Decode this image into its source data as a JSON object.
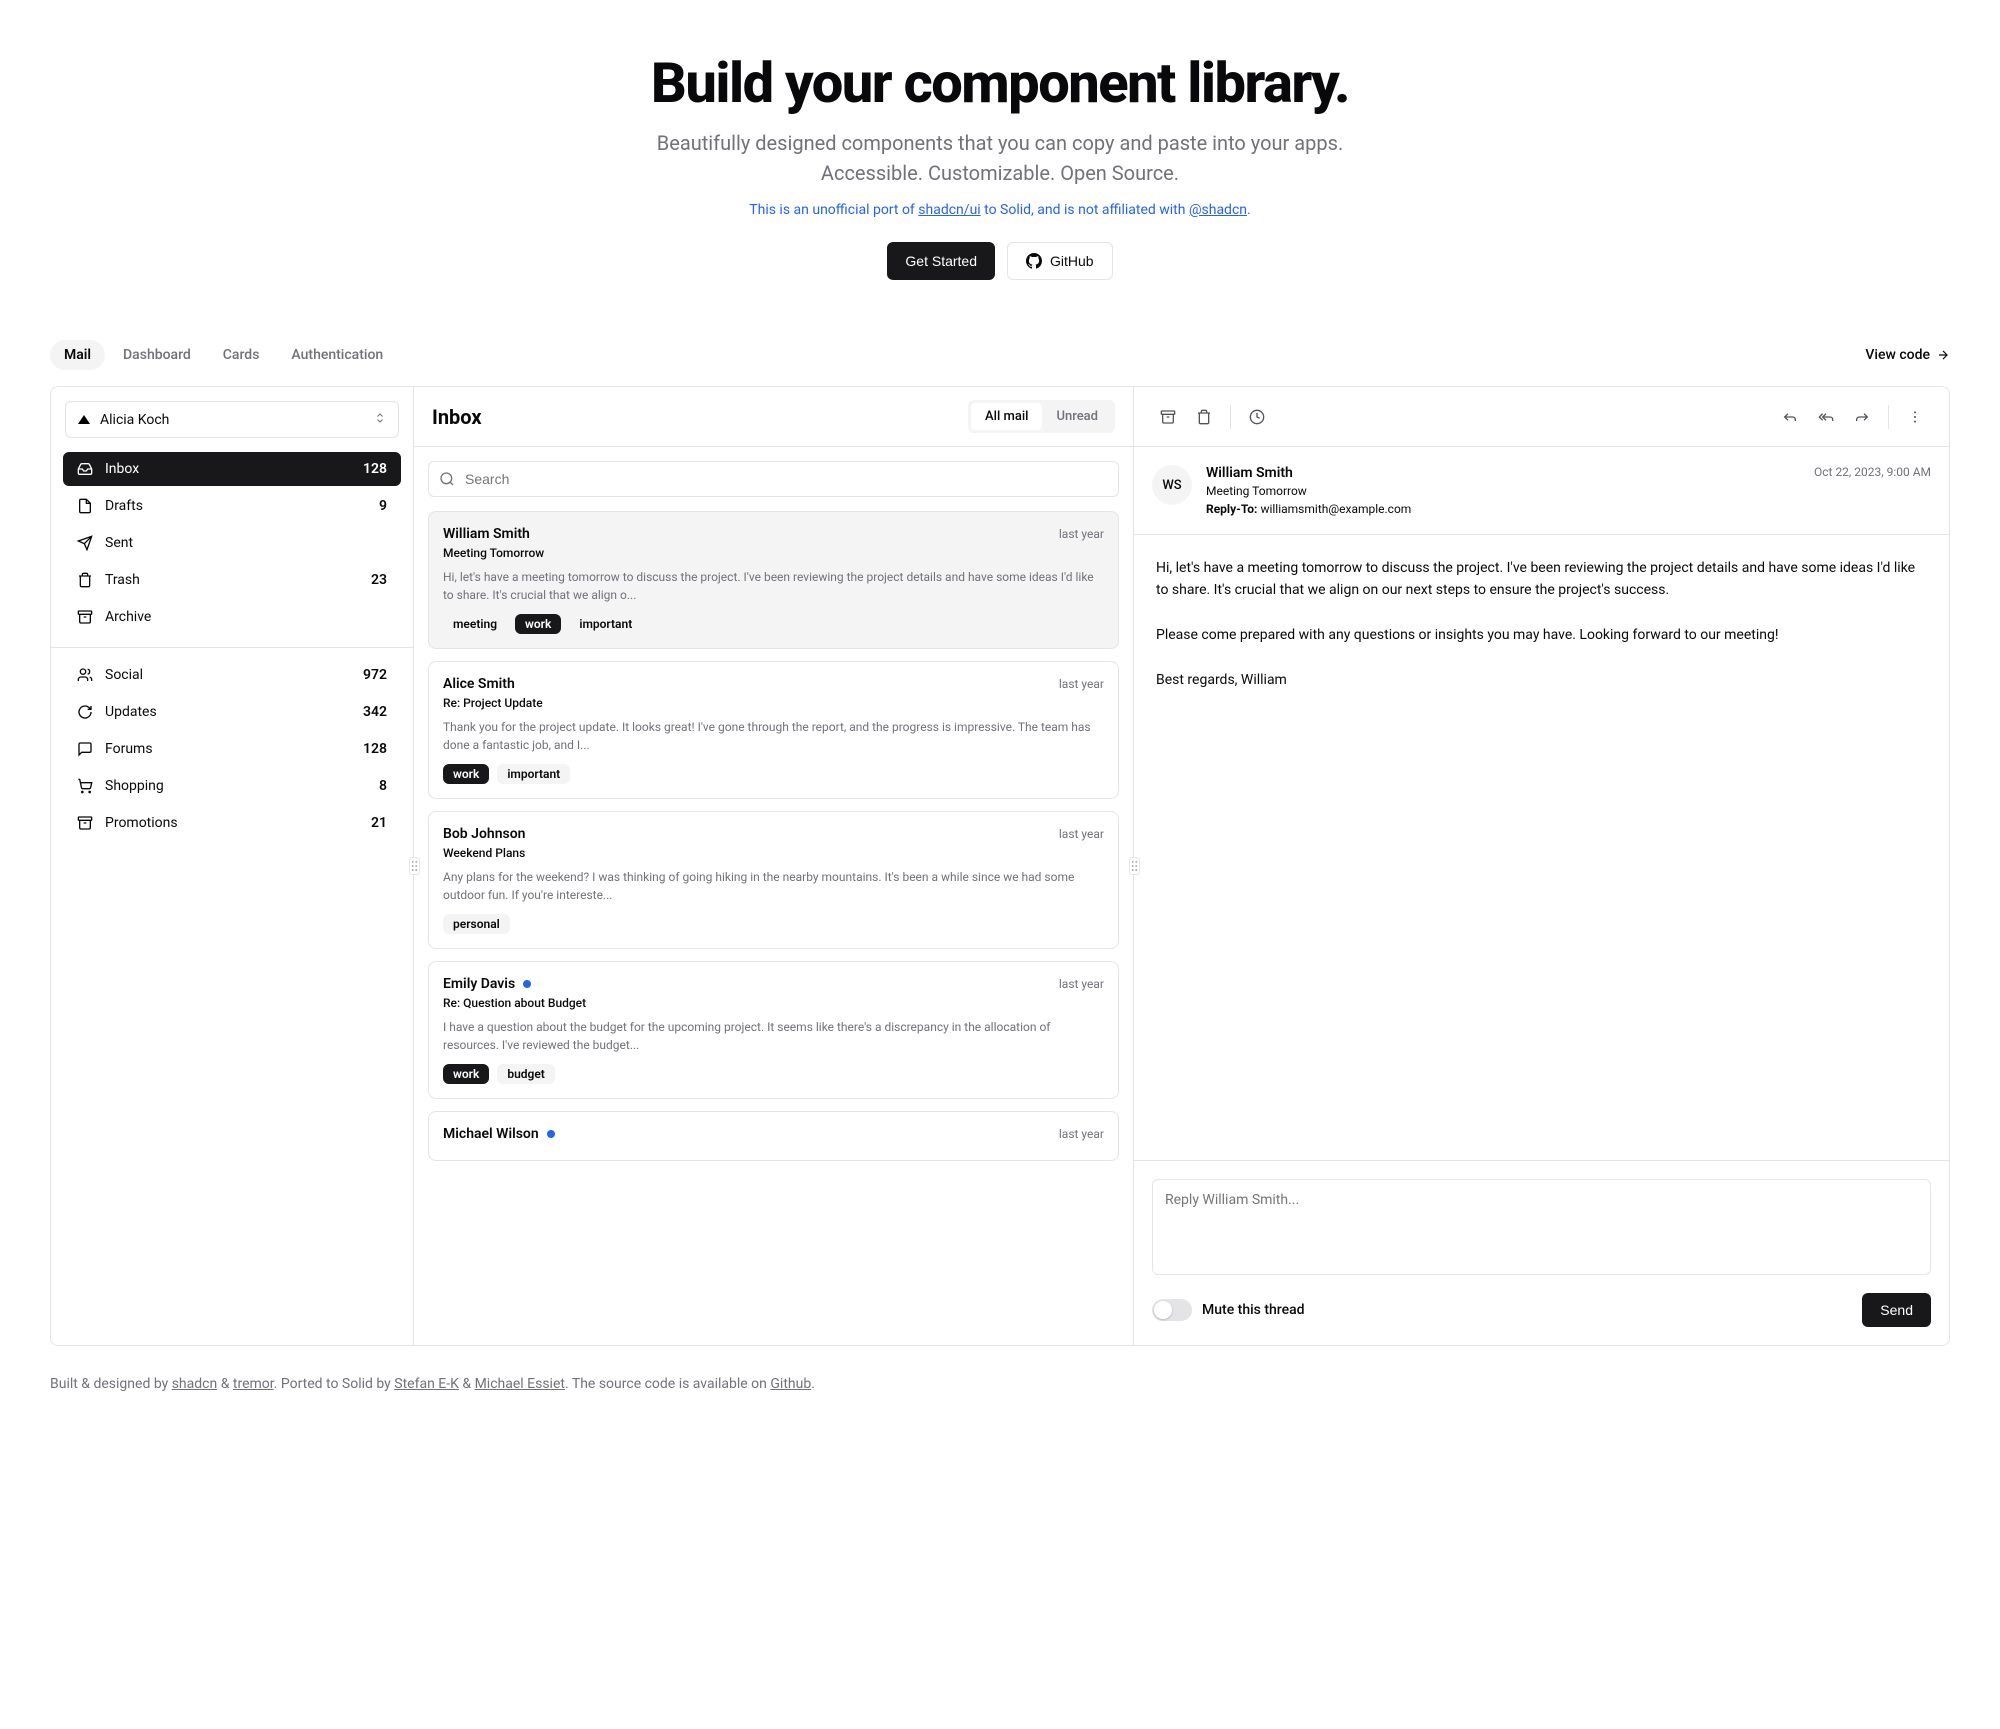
{
  "hero": {
    "title": "Build your component library.",
    "subtitle": "Beautifully designed components that you can copy and paste into your apps. Accessible. Customizable. Open Source.",
    "port_prefix": "This is an unofficial port of ",
    "port_link1": "shadcn/ui",
    "port_mid": " to Solid, and is not affiliated with ",
    "port_link2": "@shadcn",
    "get_started": "Get Started",
    "github": "GitHub"
  },
  "tabs": [
    "Mail",
    "Dashboard",
    "Cards",
    "Authentication"
  ],
  "view_code": "View code",
  "account": {
    "name": "Alicia Koch"
  },
  "nav_primary": [
    {
      "label": "Inbox",
      "count": "128",
      "active": true
    },
    {
      "label": "Drafts",
      "count": "9"
    },
    {
      "label": "Sent",
      "count": ""
    },
    {
      "label": "Trash",
      "count": "23"
    },
    {
      "label": "Archive",
      "count": ""
    }
  ],
  "nav_secondary": [
    {
      "label": "Social",
      "count": "972"
    },
    {
      "label": "Updates",
      "count": "342"
    },
    {
      "label": "Forums",
      "count": "128"
    },
    {
      "label": "Shopping",
      "count": "8"
    },
    {
      "label": "Promotions",
      "count": "21"
    }
  ],
  "inbox_title": "Inbox",
  "seg": {
    "all": "All mail",
    "unread": "Unread"
  },
  "search_placeholder": "Search",
  "mails": [
    {
      "from": "William Smith",
      "subject": "Meeting Tomorrow",
      "time": "last year",
      "unread": false,
      "selected": true,
      "preview": "Hi, let's have a meeting tomorrow to discuss the project. I've been reviewing the project details and have some ideas I'd like to share. It's crucial that we align o...",
      "tags": [
        {
          "t": "meeting"
        },
        {
          "t": "work",
          "d": true
        },
        {
          "t": "important"
        }
      ]
    },
    {
      "from": "Alice Smith",
      "subject": "Re: Project Update",
      "time": "last year",
      "unread": false,
      "preview": "Thank you for the project update. It looks great! I've gone through the report, and the progress is impressive. The team has done a fantastic job, and I...",
      "tags": [
        {
          "t": "work",
          "d": true
        },
        {
          "t": "important"
        }
      ]
    },
    {
      "from": "Bob Johnson",
      "subject": "Weekend Plans",
      "time": "last year",
      "unread": false,
      "preview": "Any plans for the weekend? I was thinking of going hiking in the nearby mountains. It's been a while since we had some outdoor fun. If you're intereste...",
      "tags": [
        {
          "t": "personal"
        }
      ]
    },
    {
      "from": "Emily Davis",
      "subject": "Re: Question about Budget",
      "time": "last year",
      "unread": true,
      "preview": "I have a question about the budget for the upcoming project. It seems like there's a discrepancy in the allocation of resources. I've reviewed the budget...",
      "tags": [
        {
          "t": "work",
          "d": true
        },
        {
          "t": "budget"
        }
      ]
    },
    {
      "from": "Michael Wilson",
      "subject": "",
      "time": "last year",
      "unread": true,
      "preview": "",
      "tags": []
    }
  ],
  "detail": {
    "initials": "WS",
    "from": "William Smith",
    "subject": "Meeting Tomorrow",
    "reply_to_label": "Reply-To:",
    "reply_to": "williamsmith@example.com",
    "date": "Oct 22, 2023, 9:00 AM",
    "body": "Hi, let's have a meeting tomorrow to discuss the project. I've been reviewing the project details and have some ideas I'd like to share. It's crucial that we align on our next steps to ensure the project's success.\n\nPlease come prepared with any questions or insights you may have. Looking forward to our meeting!\n\nBest regards, William",
    "reply_placeholder": "Reply William Smith...",
    "mute": "Mute this thread",
    "send": "Send"
  },
  "footer": {
    "p1": "Built & designed by ",
    "shadcn": "shadcn",
    "amp": " & ",
    "tremor": "tremor",
    "p2": ". Ported to Solid by ",
    "stefan": "Stefan E-K",
    "michael": "Michael Essiet",
    "p3": ". The source code is available on ",
    "github": "Github",
    "dot": "."
  }
}
